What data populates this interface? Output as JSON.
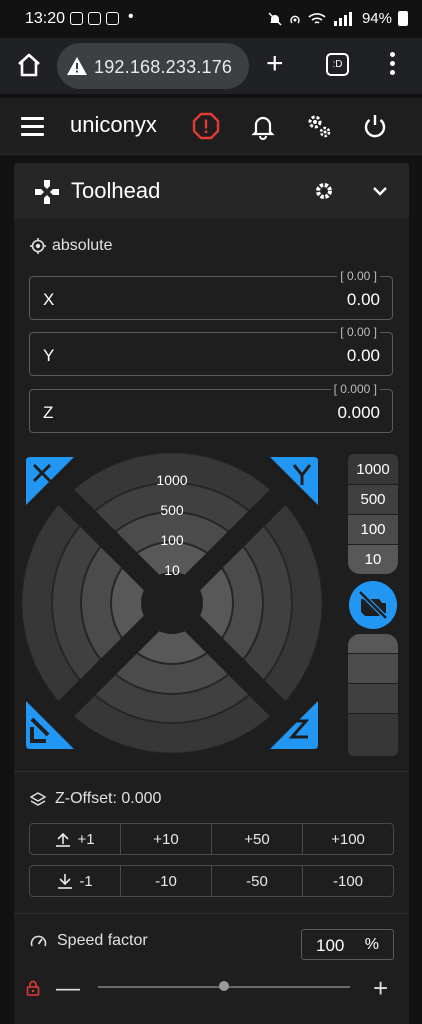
{
  "status_bar": {
    "time": "13:20",
    "dot": "•",
    "battery": "94%"
  },
  "browser": {
    "url": "192.168.233.176",
    "new_tab": "+",
    "tabs_label": ":D"
  },
  "app": {
    "title": "uniconyx"
  },
  "panel": {
    "title": "Toolhead",
    "position_mode": "absolute",
    "fields": [
      {
        "axis": "X",
        "value": "0.00",
        "hint": "[ 0.00 ]"
      },
      {
        "axis": "Y",
        "value": "0.00",
        "hint": "[ 0.00 ]"
      },
      {
        "axis": "Z",
        "value": "0.000",
        "hint": "[ 0.000 ]"
      }
    ],
    "jog_steps": [
      "1000",
      "500",
      "100",
      "10"
    ],
    "z_steps": [
      "1000",
      "500",
      "100",
      "10"
    ],
    "z_offset_label": "Z-Offset: 0.000",
    "z_offset_up": [
      "+1",
      "+10",
      "+50",
      "+100"
    ],
    "z_offset_down": [
      "-1",
      "-10",
      "-50",
      "-100"
    ],
    "speed_label": "Speed factor",
    "speed_value": "100",
    "speed_unit": "%",
    "speed_fraction": 0.5
  },
  "colors": {
    "accent": "#2196f3",
    "danger": "#e53935"
  }
}
